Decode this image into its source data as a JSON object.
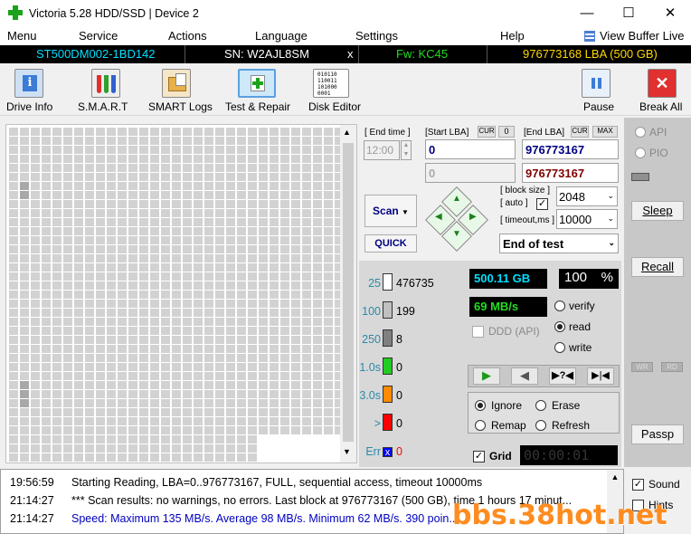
{
  "window": {
    "title": "Victoria 5.28 HDD/SSD | Device 2"
  },
  "menu": {
    "items": [
      "Menu",
      "Service",
      "Actions",
      "Language",
      "Settings",
      "Help"
    ],
    "view_buffer": "View Buffer Live"
  },
  "device": {
    "model": "ST500DM002-1BD142",
    "serial": "SN: W2AJL8SM",
    "close": "x",
    "firmware": "Fw: KC45",
    "capacity": "976773168 LBA (500 GB)"
  },
  "toolbar": {
    "drive_info": "Drive Info",
    "smart": "S.M.A.R.T",
    "smart_logs": "SMART Logs",
    "test_repair": "Test & Repair",
    "disk_editor": "Disk Editor",
    "pause": "Pause",
    "break_all": "Break All"
  },
  "scan_params": {
    "end_time_label": "[ End time ]",
    "end_time": "12:00",
    "start_lba_label": "[Start LBA]",
    "cur_label": "CUR",
    "cur_value": "0",
    "start_lba": "0",
    "start_lba_cur": "0",
    "end_lba_label": "[End LBA]",
    "cur2_label": "CUR",
    "max_label": "MAX",
    "end_lba": "976773167",
    "end_lba_cur": "976773167",
    "block_size_label": "[ block size ]",
    "auto_label": "[ auto ]",
    "timeout_label": "[ timeout,ms ]",
    "block_size": "2048",
    "timeout": "10000",
    "scan_button": "Scan",
    "quick_button": "QUICK",
    "end_action": "End of test"
  },
  "stats": {
    "rows": [
      {
        "label": "25",
        "count": "476735",
        "color": "#ffffff"
      },
      {
        "label": "100",
        "count": "199",
        "color": "#c0c0c0"
      },
      {
        "label": "250",
        "count": "8",
        "color": "#808080"
      },
      {
        "label": "1.0s",
        "count": "0",
        "color": "#22cc22"
      },
      {
        "label": "3.0s",
        "count": "0",
        "color": "#ff8c00"
      },
      {
        "label": ">",
        "count": "0",
        "color": "#ff0000"
      },
      {
        "label": "Err",
        "count": "0",
        "color": "#0000ff",
        "mark": "x"
      }
    ],
    "processed": "500.11 GB",
    "percent": "100",
    "percent_unit": "%",
    "speed": "69 MB/s",
    "ddd": "DDD (API)",
    "verify": "verify",
    "read": "read",
    "write": "write",
    "ignore": "Ignore",
    "erase": "Erase",
    "remap": "Remap",
    "refresh": "Refresh",
    "grid": "Grid",
    "timer": "00:00:01"
  },
  "sidebar": {
    "api": "API",
    "pio": "PIO",
    "sleep": "Sleep",
    "recall": "Recall",
    "wr": "WR",
    "rd": "RD",
    "passp": "Passp",
    "sound": "Sound",
    "hints": "Hints"
  },
  "log": [
    {
      "time": "19:56:59",
      "text": "Starting Reading, LBA=0..976773167, FULL, sequential access, timeout 10000ms",
      "color": "#000000"
    },
    {
      "time": "21:14:27",
      "text": "*** Scan results: no warnings, no errors. Last block at 976773167 (500 GB), time 1 hours 17 minut...",
      "color": "#000000"
    },
    {
      "time": "21:14:27",
      "text": "Speed: Maximum 135 MB/s. Average 98 MB/s. Minimum 62 MB/s. 390 poin...",
      "color": "#0000c0"
    }
  ],
  "watermark": "bbs.38hot.net"
}
